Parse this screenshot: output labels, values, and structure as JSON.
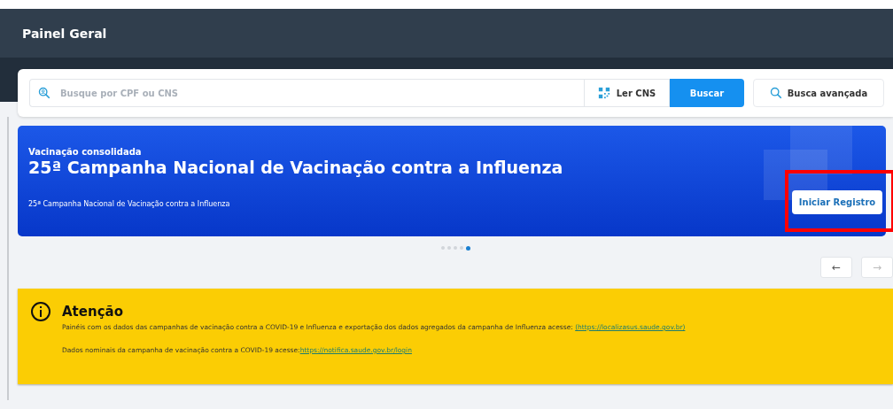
{
  "header": {
    "title": "Painel Geral"
  },
  "search": {
    "placeholder": "Busque por CPF ou CNS",
    "read_button": "Ler CNS",
    "search_button": "Buscar",
    "advanced_button": "Busca avançada"
  },
  "banner": {
    "eyebrow": "Vacinação consolidada",
    "title": "25ª Campanha Nacional de Vacinação contra a Influenza",
    "subtitle": "25ª Campanha Nacional de Vacinação contra a Influenza",
    "button": "Iniciar Registro",
    "highlighted": true
  },
  "carousel_dots": [
    {
      "selected": false
    },
    {
      "selected": false
    },
    {
      "selected": false
    },
    {
      "selected": false
    },
    {
      "selected": true
    }
  ],
  "nav_buttons": [
    {
      "label": "←",
      "disabled": false
    },
    {
      "label": "→",
      "disabled": true
    }
  ],
  "alert": {
    "title": "Atenção",
    "lines": [
      {
        "text": "Painéis com os dados das campanhas de vacinação contra a COVID-19 e Influenza e exportação dos dados agregados da campanha de Influenza acesse: ",
        "link": "(https://localizasus.saude.gov.br)"
      },
      {
        "text": "Dados nominais da campanha de vacinação contra a COVID-19 acesse:",
        "link": "https://notifica.saude.gov.br/login"
      }
    ]
  }
}
